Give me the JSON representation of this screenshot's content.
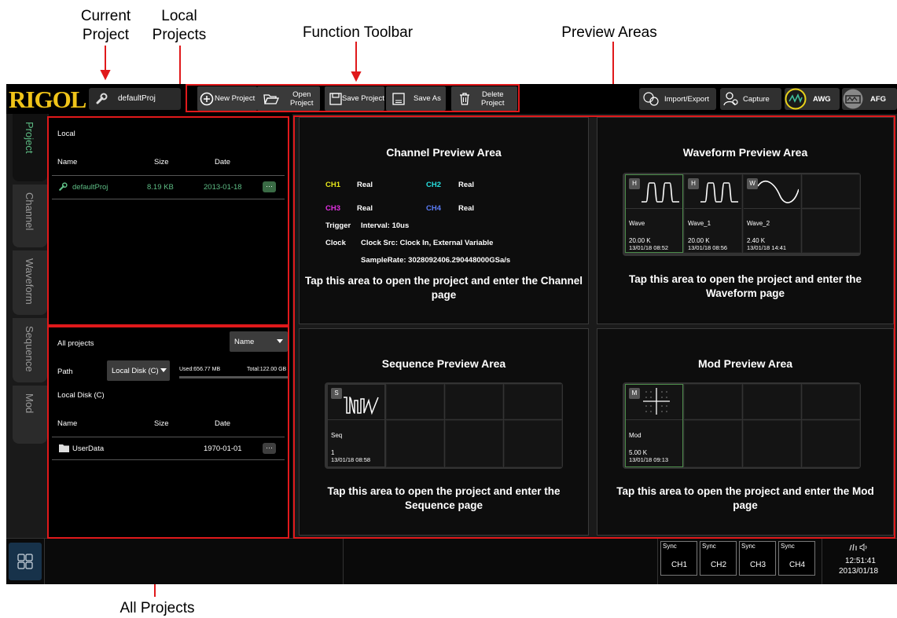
{
  "callouts": {
    "current_project": "Current\nProject",
    "local_projects": "Local\nProjects",
    "function_toolbar": "Function Toolbar",
    "preview_areas": "Preview Areas",
    "all_projects": "All Projects"
  },
  "logo": "RIGOL",
  "current_project": "defaultProj",
  "toolbar": {
    "new_project": "New Project",
    "open_project": "Open\nProject",
    "save_project": "Save Project",
    "save_as": "Save As",
    "delete_project": "Delete\nProject"
  },
  "right_buttons": {
    "import_export": "Import/Export",
    "capture": "Capture",
    "awg": "AWG",
    "afg": "AFG"
  },
  "side_tabs": [
    "Project",
    "Channel",
    "Waveform",
    "Sequence",
    "Mod"
  ],
  "local": {
    "title": "Local",
    "headers": [
      "Name",
      "Size",
      "Date"
    ],
    "rows": [
      {
        "name": "defaultProj",
        "size": "8.19 KB",
        "date": "2013-01-18"
      }
    ]
  },
  "all": {
    "title": "All projects",
    "sort": "Name",
    "path_label": "Path",
    "disk": "Local Disk (C)",
    "used": "Used:656.77 MB",
    "total": "Total:122.00 GB",
    "disk_title": "Local Disk (C)",
    "headers": [
      "Name",
      "Size",
      "Date"
    ],
    "rows": [
      {
        "name": "UserData",
        "size": "",
        "date": "1970-01-01"
      }
    ]
  },
  "channel_preview": {
    "title": "Channel Preview Area",
    "ch1": "CH1",
    "ch1_val": "Real",
    "ch2": "CH2",
    "ch2_val": "Real",
    "ch3": "CH3",
    "ch3_val": "Real",
    "ch4": "CH4",
    "ch4_val": "Real",
    "trigger": "Trigger",
    "trigger_val": "Interval: 10us",
    "clock": "Clock",
    "clock_val": "Clock Src: Clock In, External Variable",
    "samplerate": "SampleRate: 3028092406.290448000GSa/s",
    "footer": "Tap this area to open the project and enter the Channel\npage",
    "colors": {
      "ch1": "#e8e81a",
      "ch2": "#27e0e0",
      "ch3": "#e030e0",
      "ch4": "#5b7cf5"
    }
  },
  "waveform_preview": {
    "title": "Waveform Preview Area",
    "items": [
      {
        "badge": "H",
        "name": "Wave",
        "points": "20.00 K",
        "time": "13/01/18 08:52"
      },
      {
        "badge": "H",
        "name": "Wave_1",
        "points": "20.00 K",
        "time": "13/01/18 08:56"
      },
      {
        "badge": "W",
        "name": "Wave_2",
        "points": "2.40 K",
        "time": "13/01/18 14:41"
      }
    ],
    "footer": "Tap this area to open the project and enter the\nWaveform page"
  },
  "sequence_preview": {
    "title": "Sequence Preview Area",
    "item": {
      "badge": "S",
      "name": "Seq",
      "count": "1",
      "time": "13/01/18 08:58"
    },
    "footer": "Tap this area to open the project and enter the\nSequence page"
  },
  "mod_preview": {
    "title": "Mod Preview Area",
    "item": {
      "badge": "M",
      "name": "Mod",
      "points": "5.00 K",
      "time": "13/01/18 09:13"
    },
    "footer": "Tap this area to open the project and enter the Mod\npage"
  },
  "status": {
    "sync": [
      "Sync",
      "Sync",
      "Sync",
      "Sync"
    ],
    "channels": [
      "CH1",
      "CH2",
      "CH3",
      "CH4"
    ],
    "time": "12:51:41",
    "date": "2013/01/18"
  },
  "icons": [
    "wrench-icon",
    "plus-circle-icon",
    "folder-open-icon",
    "save-icon",
    "save-as-icon",
    "trash-icon",
    "import-export-icon",
    "capture-icon",
    "awg-icon",
    "afg-icon",
    "folder-icon",
    "apps-icon",
    "network-icon",
    "speaker-icon"
  ]
}
